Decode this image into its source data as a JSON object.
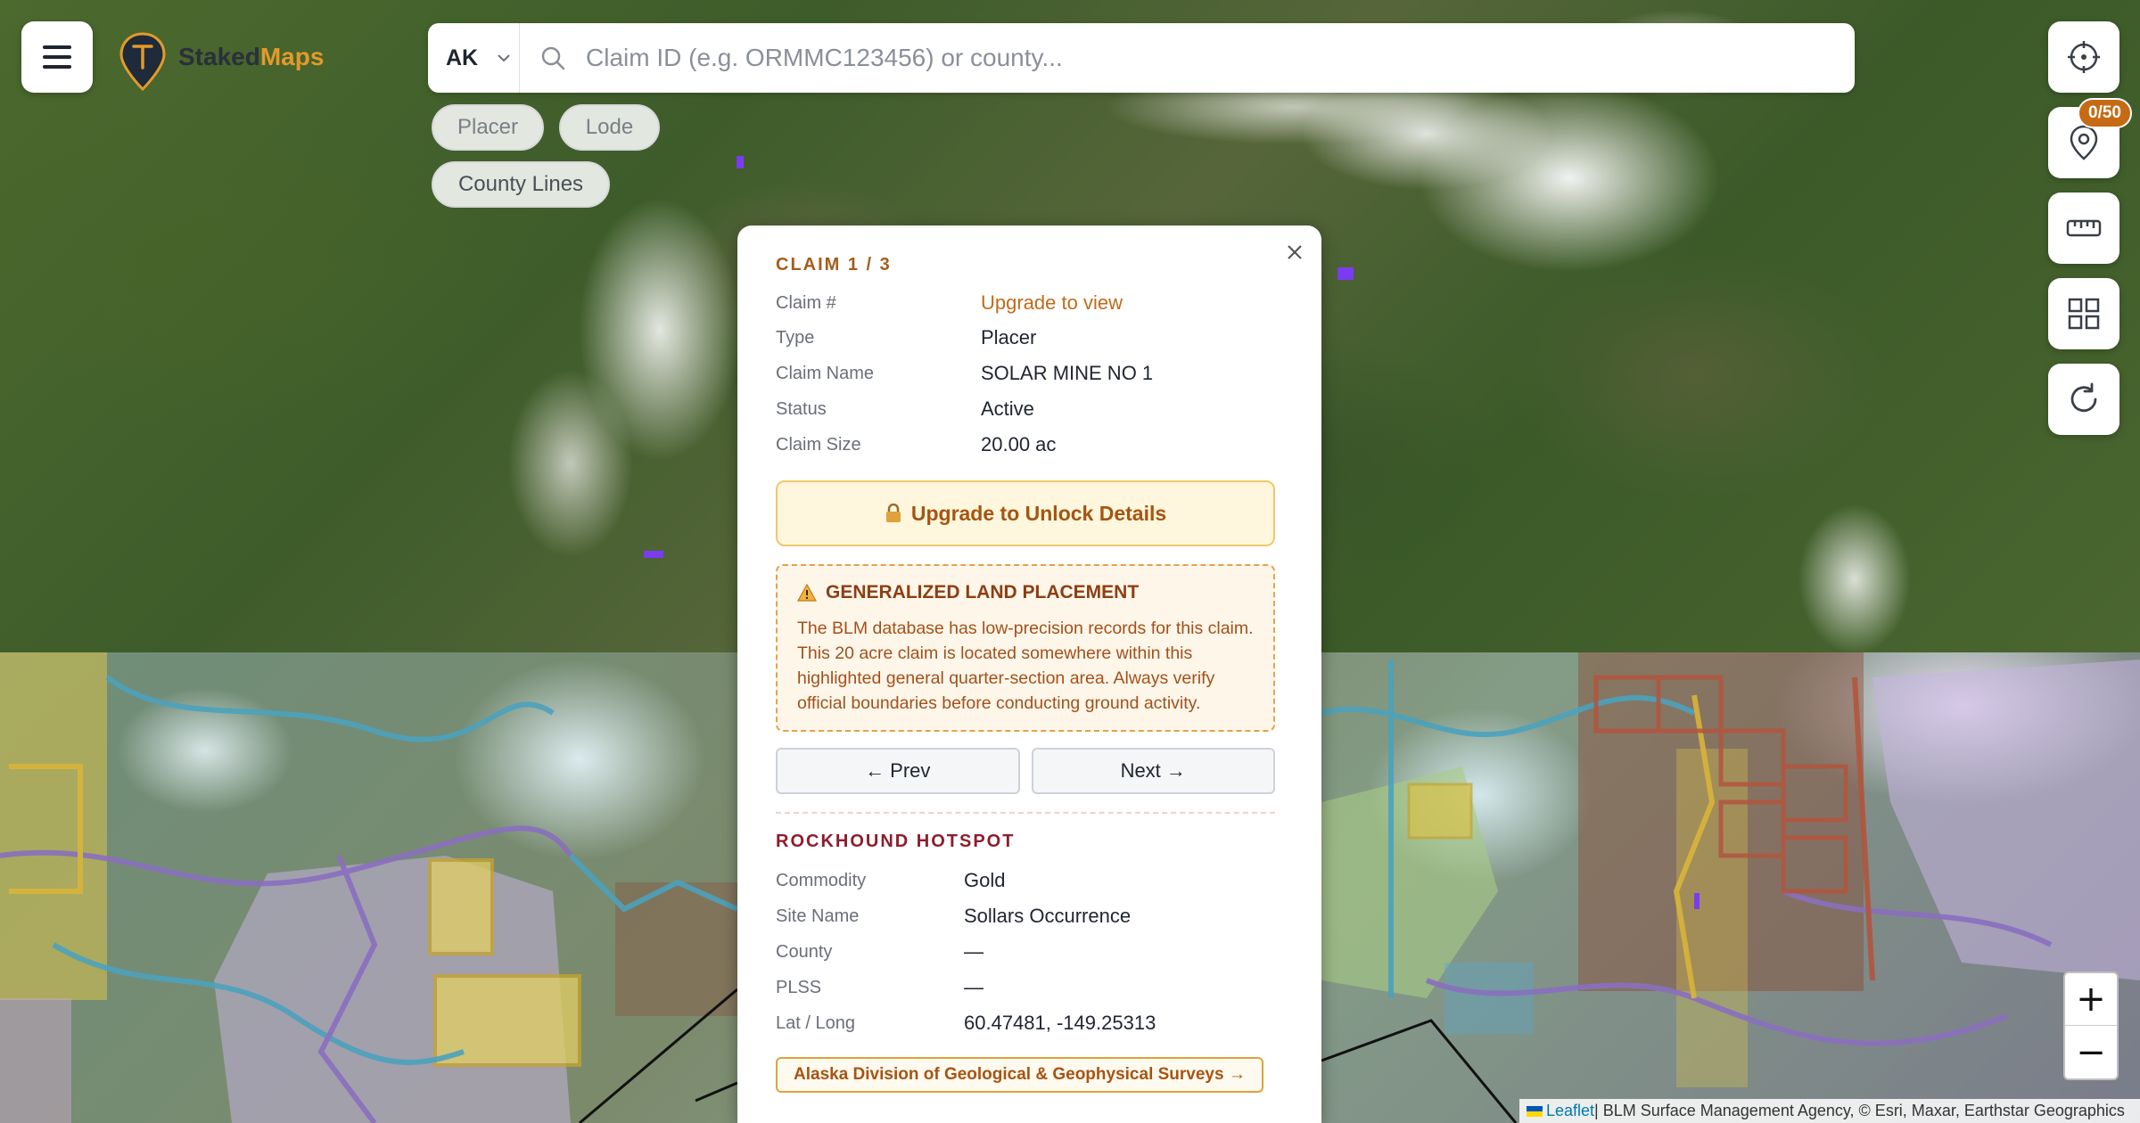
{
  "header": {
    "brand_part1": "Staked",
    "brand_part2": "Maps",
    "state_value": "AK",
    "search_placeholder": "Claim ID (e.g. ORMMC123456) or county..."
  },
  "filters": {
    "placer_label": "Placer",
    "lode_label": "Lode",
    "county_lines_label": "County Lines"
  },
  "toolbar": {
    "pin_badge": "0/50",
    "icons": [
      "crosshair-icon",
      "map-pin-icon",
      "ruler-icon",
      "grid-icon",
      "refresh-icon"
    ]
  },
  "zoom": {
    "in_label": "+",
    "out_label": "−"
  },
  "attribution": {
    "leaflet": "Leaflet",
    "text": " | BLM Surface Management Agency, © Esri, Maxar, Earthstar Geographics"
  },
  "popup": {
    "title": "CLAIM 1 / 3",
    "fields": [
      {
        "label": "Claim #",
        "value": "Upgrade to view"
      },
      {
        "label": "Type",
        "value": "Placer"
      },
      {
        "label": "Claim Name",
        "value": "SOLAR MINE NO 1"
      },
      {
        "label": "Status",
        "value": "Active"
      },
      {
        "label": "Claim Size",
        "value": "20.00 ac"
      }
    ],
    "unlock_label": "Upgrade to Unlock Details",
    "warning_title": "GENERALIZED LAND PLACEMENT",
    "warning_text": "The BLM database has low-precision records for this claim. This 20 acre claim is located somewhere within this highlighted general quarter-section area. Always verify official boundaries before conducting ground activity.",
    "prev_label": "← Prev",
    "next_label": "Next →",
    "hotspot_title": "ROCKHOUND HOTSPOT",
    "hotspot_fields": [
      {
        "label": "Commodity",
        "value": "Gold"
      },
      {
        "label": "Site Name",
        "value": "Sollars Occurrence"
      },
      {
        "label": "County",
        "value": "—"
      },
      {
        "label": "PLSS",
        "value": "—"
      },
      {
        "label": "Lat / Long",
        "value": "60.47481, -149.25313"
      }
    ],
    "external_link": "Alaska Division of Geological & Geophysical Surveys →"
  },
  "colors": {
    "accent": "#c26a18",
    "brand_orange": "#e39a2b",
    "badge": "#c66a14",
    "hotspot_title": "#8d1d2c"
  }
}
